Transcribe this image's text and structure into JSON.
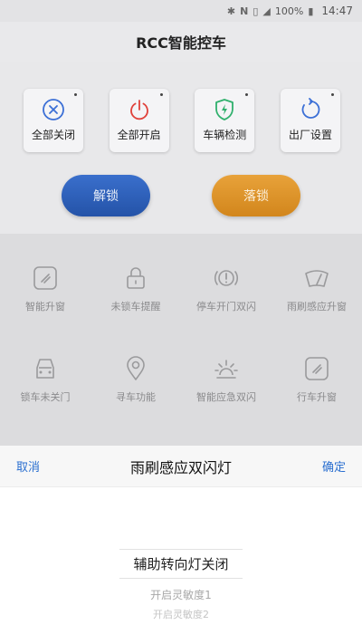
{
  "status_bar": {
    "battery": "100%",
    "time": "14:47",
    "icons": [
      "bluetooth-icon",
      "nfc-icon",
      "vibrate-icon",
      "signal-icon",
      "battery-icon"
    ]
  },
  "header": {
    "title": "RCC智能控车"
  },
  "quick_actions": [
    {
      "label": "全部关闭",
      "icon": "close-circle-icon",
      "color": "#3b6fd6"
    },
    {
      "label": "全部开启",
      "icon": "power-icon",
      "color": "#e0413a"
    },
    {
      "label": "车辆检测",
      "icon": "shield-bolt-icon",
      "color": "#2fb06c"
    },
    {
      "label": "出厂设置",
      "icon": "reset-icon",
      "color": "#3b6fd6"
    }
  ],
  "buttons": {
    "unlock": "解锁",
    "lock": "落锁"
  },
  "features": [
    {
      "label": "智能升窗",
      "icon": "window-up-icon"
    },
    {
      "label": "未锁车提醒",
      "icon": "padlock-icon"
    },
    {
      "label": "停车开门双闪",
      "icon": "hazard-icon"
    },
    {
      "label": "雨刷感应升窗",
      "icon": "wiper-icon"
    },
    {
      "label": "锁车未关门",
      "icon": "car-door-icon"
    },
    {
      "label": "寻车功能",
      "icon": "location-pin-icon"
    },
    {
      "label": "智能应急双闪",
      "icon": "emergency-light-icon"
    },
    {
      "label": "行车升窗",
      "icon": "window-drive-icon"
    }
  ],
  "sheet": {
    "cancel": "取消",
    "title": "雨刷感应双闪灯",
    "confirm": "确定",
    "options": [
      "辅助转向灯关闭",
      "开启灵敏度1",
      "开启灵敏度2"
    ]
  },
  "colors": {
    "unlock": "#2d5fb8",
    "lock": "#e0961f",
    "link": "#2a6fd0"
  }
}
